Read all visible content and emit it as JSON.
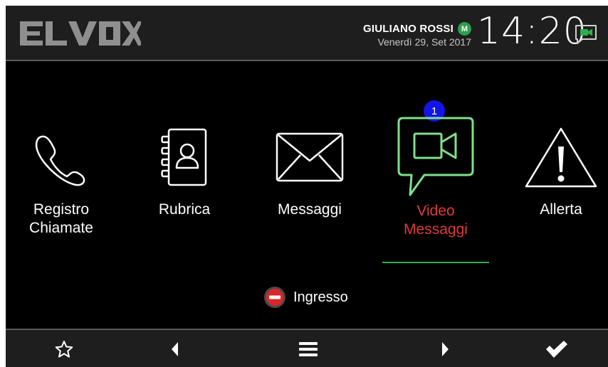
{
  "header": {
    "brand": "ELVOX",
    "user_name": "GIULIANO ROSSI",
    "user_badge": "M",
    "date": "Venerdì 29, Set 2017",
    "time": "14:20",
    "message_icon": "video-message-icon"
  },
  "menu": {
    "items": [
      {
        "label": "Registro\nChiamate",
        "icon": "phone-icon"
      },
      {
        "label": "Rubrica",
        "icon": "address-book-icon"
      },
      {
        "label": "Messaggi",
        "icon": "envelope-icon"
      },
      {
        "label": "Video\nMessaggi",
        "icon": "video-message-icon",
        "active": true,
        "badge": "1"
      },
      {
        "label": "Allerta",
        "icon": "warning-icon"
      }
    ]
  },
  "entrance": {
    "label": "Ingresso",
    "icon": "no-entry-icon"
  },
  "bottom_bar": {
    "buttons": [
      "star-icon",
      "arrow-left-icon",
      "menu-icon",
      "arrow-right-icon",
      "check-icon"
    ]
  },
  "colors": {
    "background": "#000000",
    "bar": "#1e1e1e",
    "active_text": "#e0393a",
    "active_icon": "#7fe08a",
    "badge_blue": "#1414e6",
    "badge_green": "#2e9e4a",
    "no_entry_red": "#d9262a"
  }
}
